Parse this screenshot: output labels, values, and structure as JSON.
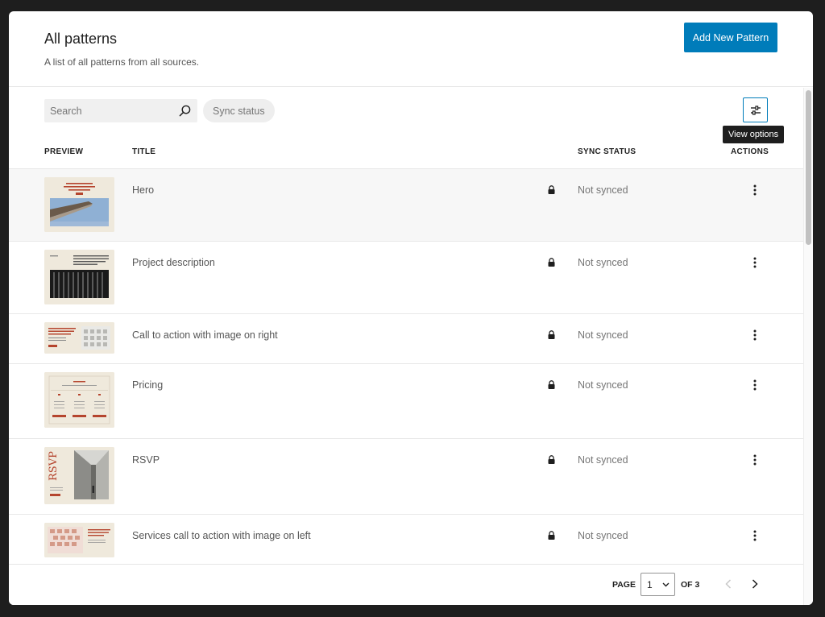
{
  "header": {
    "title": "All patterns",
    "subtitle": "A list of all patterns from all sources.",
    "add_button": "Add New Pattern"
  },
  "toolbar": {
    "search_placeholder": "Search",
    "sync_filter": "Sync status",
    "view_options_tooltip": "View options"
  },
  "table": {
    "columns": {
      "preview": "PREVIEW",
      "title": "TITLE",
      "sync_status": "SYNC STATUS",
      "actions": "ACTIONS"
    },
    "rows": [
      {
        "title": "Hero",
        "sync": "Not synced",
        "locked": true
      },
      {
        "title": "Project description",
        "sync": "Not synced",
        "locked": true
      },
      {
        "title": "Call to action with image on right",
        "sync": "Not synced",
        "locked": true
      },
      {
        "title": "Pricing",
        "sync": "Not synced",
        "locked": true
      },
      {
        "title": "RSVP",
        "sync": "Not synced",
        "locked": true
      },
      {
        "title": "Services call to action with image on left",
        "sync": "Not synced",
        "locked": true
      }
    ]
  },
  "pagination": {
    "page_label": "PAGE",
    "current_page": "1",
    "of_label": "OF 3"
  },
  "rsvp_thumb_text": "RSVP",
  "colors": {
    "accent": "#007cba",
    "thumb_bg": "#efe9dc",
    "thumb_red": "#b5452e"
  }
}
